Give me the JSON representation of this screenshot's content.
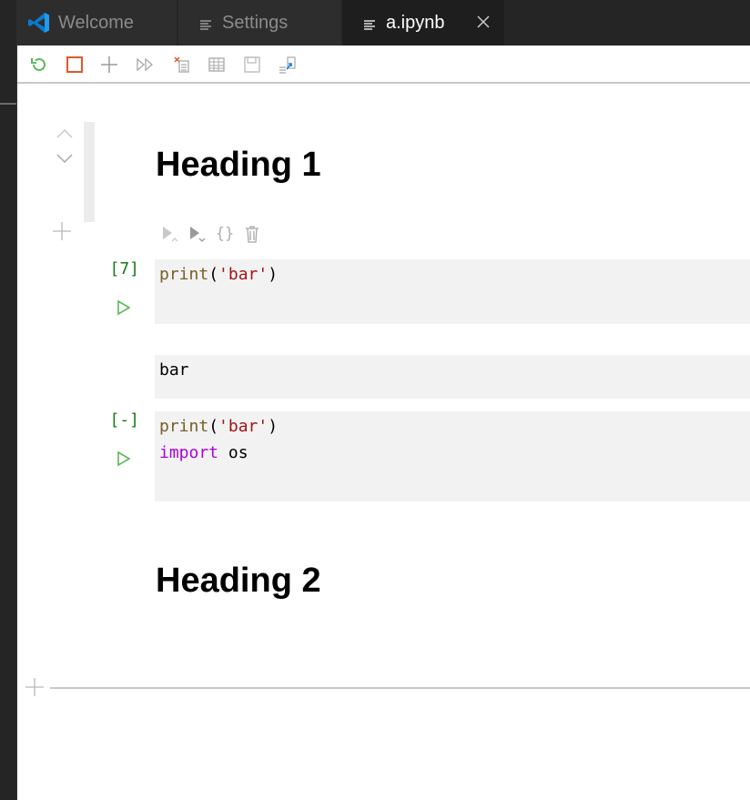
{
  "tabs": [
    {
      "label": "Welcome",
      "icon": "vscode-logo-icon"
    },
    {
      "label": "Settings",
      "icon": "file-lines-icon"
    },
    {
      "label": "a.ipynb",
      "icon": "file-lines-icon",
      "active": true
    }
  ],
  "toolbar": {
    "buttons": [
      "restart-kernel",
      "interrupt-kernel",
      "add-cell",
      "run-all",
      "clear-outputs",
      "variables",
      "save",
      "export"
    ]
  },
  "cells": {
    "heading1": "Heading 1",
    "code1": {
      "count": "[7]",
      "fn": "print",
      "open": "(",
      "str": "'bar'",
      "close": ")"
    },
    "output1": "bar",
    "code2": {
      "count": "[-]",
      "fn": "print",
      "open": "(",
      "str": "'bar'",
      "close": ")",
      "kw": "import",
      "mod": " os"
    },
    "heading2": "Heading 2"
  },
  "cell_toolbar": {
    "braces": "{}"
  },
  "colors": {
    "accent_green": "#5cb85c",
    "stop_red": "#e2582b",
    "exec_green": "#1a7a1a",
    "string": "#a31515",
    "function": "#795e26",
    "keyword": "#af00db"
  }
}
